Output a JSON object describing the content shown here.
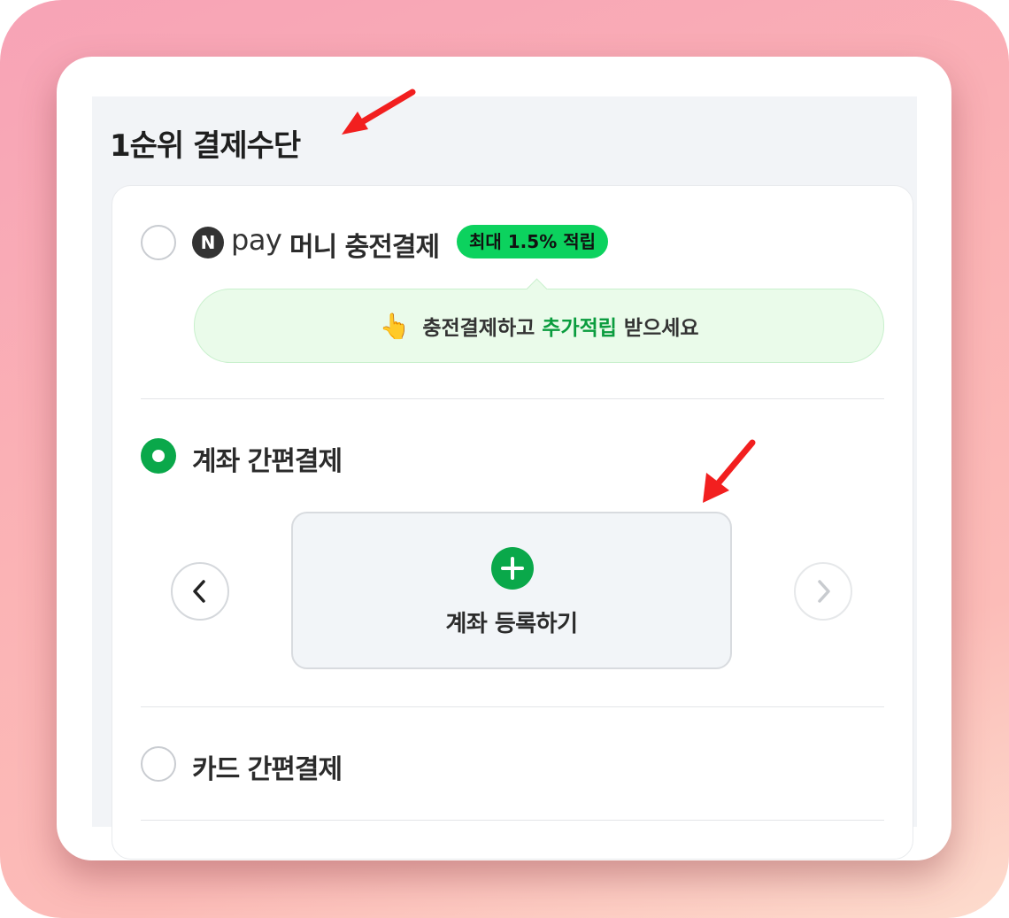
{
  "section": {
    "title": "1순위 결제수단"
  },
  "npay": {
    "logo_letter": "N",
    "pay_word": "pay",
    "label": "머니 충전결제",
    "badge": "최대 1.5% 적립",
    "tip_pre": "충전결제하고",
    "tip_highlight": "추가적립",
    "tip_post": "받으세요",
    "selected": false
  },
  "account": {
    "label": "계좌 간편결제",
    "selected": true,
    "add_label": "계좌 등록하기"
  },
  "card": {
    "label": "카드 간편결제",
    "selected": false
  },
  "icons": {
    "hand": "pointing-hand-icon",
    "prev": "chevron-left-icon",
    "next": "chevron-right-icon",
    "plus": "plus-icon"
  },
  "colors": {
    "accent_green": "#0aa84a",
    "badge_green": "#0cd25e",
    "annotation_red": "#f21f1f"
  }
}
